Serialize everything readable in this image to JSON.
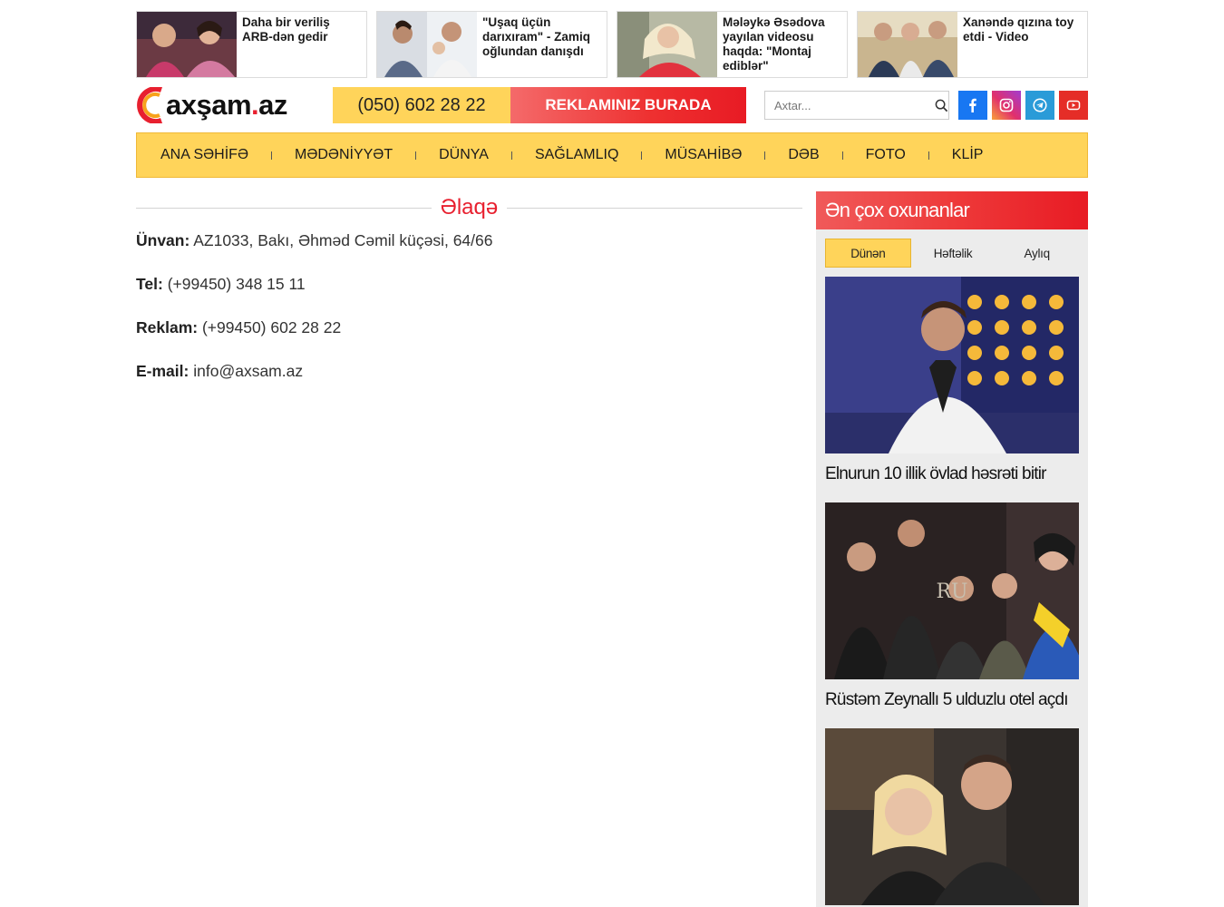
{
  "top_news": [
    {
      "title": "Daha bir veriliş ARB-dən gedir"
    },
    {
      "title": "\"Uşaq üçün darıxıram\" - Zamiq oğlundan danışdı"
    },
    {
      "title": "Mələykə Əsədova yayılan videosu haqda: \"Montaj ediblər\""
    },
    {
      "title": "Xanəndə qızına toy etdi - Video"
    }
  ],
  "header": {
    "logo_main": "axşam",
    "logo_dot": ".",
    "logo_tld": "az",
    "phone": "(050) 602 28 22",
    "ad_label": "REKLAMINIZ BURADA",
    "search_placeholder": "Axtar..."
  },
  "socials": [
    {
      "icon": "facebook-icon",
      "color": "#1877f2"
    },
    {
      "icon": "instagram-icon",
      "color": "#e1306c"
    },
    {
      "icon": "telegram-icon",
      "color": "#2a9bd8"
    },
    {
      "icon": "youtube-icon",
      "color": "#e52d27"
    }
  ],
  "nav": [
    {
      "label": "ANA SƏHİFƏ"
    },
    {
      "label": "MƏDƏNİYYƏT"
    },
    {
      "label": "DÜNYA"
    },
    {
      "label": "SAĞLAMLIQ"
    },
    {
      "label": "MÜSAHİBƏ"
    },
    {
      "label": "DƏB"
    },
    {
      "label": "FOTO"
    },
    {
      "label": "KLİP"
    }
  ],
  "contact": {
    "title": "Əlaqə",
    "rows": [
      {
        "label": "Ünvan:",
        "value": "AZ1033, Bakı, Əhməd Cəmil küçəsi, 64/66"
      },
      {
        "label": "Tel:",
        "value": "(+99450) 348 15 11"
      },
      {
        "label": "Reklam:",
        "value": "(+99450) 602 28 22"
      },
      {
        "label": "E-mail:",
        "value": "info@axsam.az"
      }
    ]
  },
  "sidebar": {
    "title": "Ən çox oxunanlar",
    "tabs": [
      {
        "label": "Dünən",
        "active": true
      },
      {
        "label": "Həftəlik",
        "active": false
      },
      {
        "label": "Aylıq",
        "active": false
      }
    ],
    "items": [
      {
        "title": "Elnurun 10 illik övlad həsrəti bitir"
      },
      {
        "title": "Rüstəm Zeynallı 5 ulduzlu otel açdı"
      },
      {
        "title": ""
      }
    ]
  },
  "colors": {
    "accent_yellow": "#ffd45a",
    "accent_red": "#e8202f",
    "sidebar_bg": "#ececec"
  }
}
